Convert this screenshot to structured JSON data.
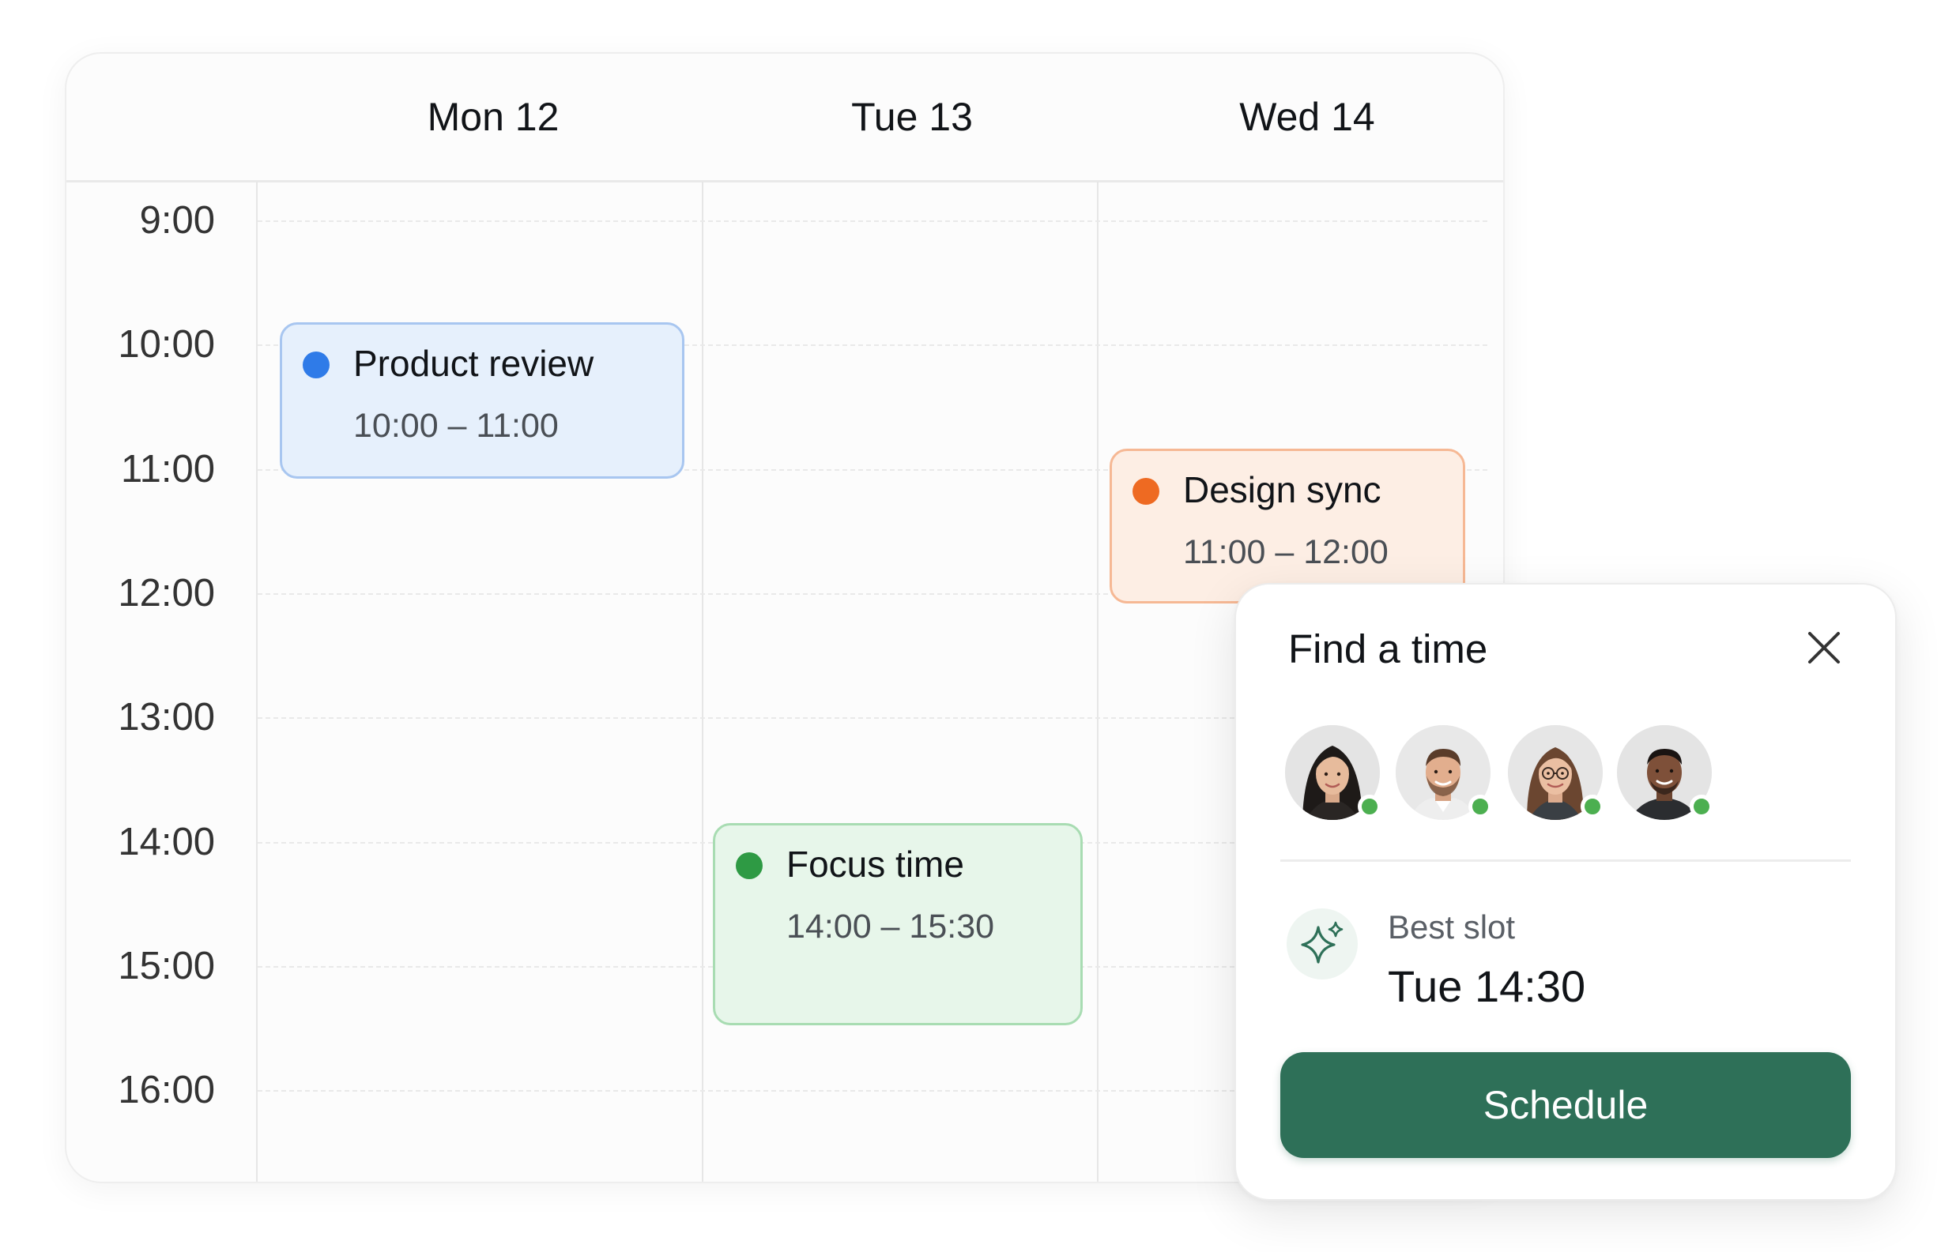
{
  "calendar": {
    "days": [
      "Mon 12",
      "Tue 13",
      "Wed 14"
    ],
    "times": [
      "9:00",
      "10:00",
      "11:00",
      "12:00",
      "13:00",
      "14:00",
      "15:00",
      "16:00"
    ],
    "events": [
      {
        "title": "Product review",
        "time": "10:00 – 11:00",
        "color": "#2f7be8"
      },
      {
        "title": "Design sync",
        "time": "11:00 – 12:00",
        "color": "#ee6a22"
      },
      {
        "title": "Focus time",
        "time": "14:00 – 15:30",
        "color": "#2e9a44"
      }
    ]
  },
  "finder": {
    "title": "Find a time",
    "close_icon": "close-icon",
    "participants_online": [
      true,
      true,
      true,
      true
    ],
    "best_slot_icon": "sparkle-icon",
    "best_slot_label": "Best slot",
    "best_slot_value": "Tue 14:30",
    "schedule_label": "Schedule",
    "accent_color": "#2e7058",
    "online_color": "#4caf50"
  }
}
